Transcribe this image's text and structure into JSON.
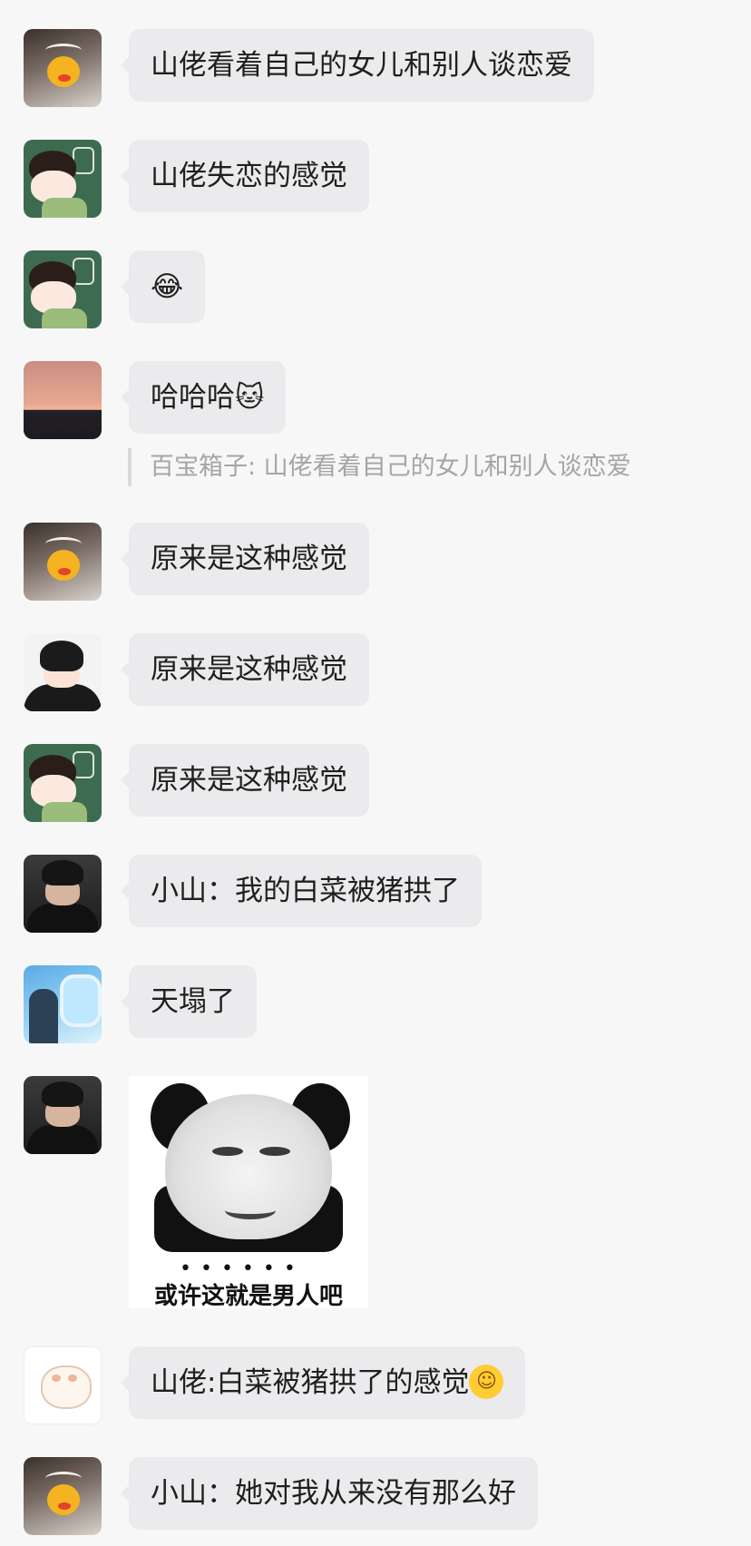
{
  "messages": [
    {
      "text": "山佬看着自己的女儿和别人谈恋爱"
    },
    {
      "text": "山佬失恋的感觉"
    },
    {
      "text": "😂"
    },
    {
      "text": "哈哈哈",
      "emoji": "🐱"
    },
    {
      "quote": "百宝箱子: 山佬看着自己的女儿和别人谈恋爱"
    },
    {
      "text": "原来是这种感觉"
    },
    {
      "text": "原来是这种感觉"
    },
    {
      "text": "原来是这种感觉"
    },
    {
      "text": "小山：我的白菜被猪拱了"
    },
    {
      "text": "天塌了"
    },
    {
      "sticker_caption": "或许这就是男人吧",
      "sticker_dots": "••••••"
    },
    {
      "text": "山佬:白菜被猪拱了的感觉",
      "emoji": "☺"
    },
    {
      "text": "小山：她对我从来没有那么好"
    }
  ]
}
